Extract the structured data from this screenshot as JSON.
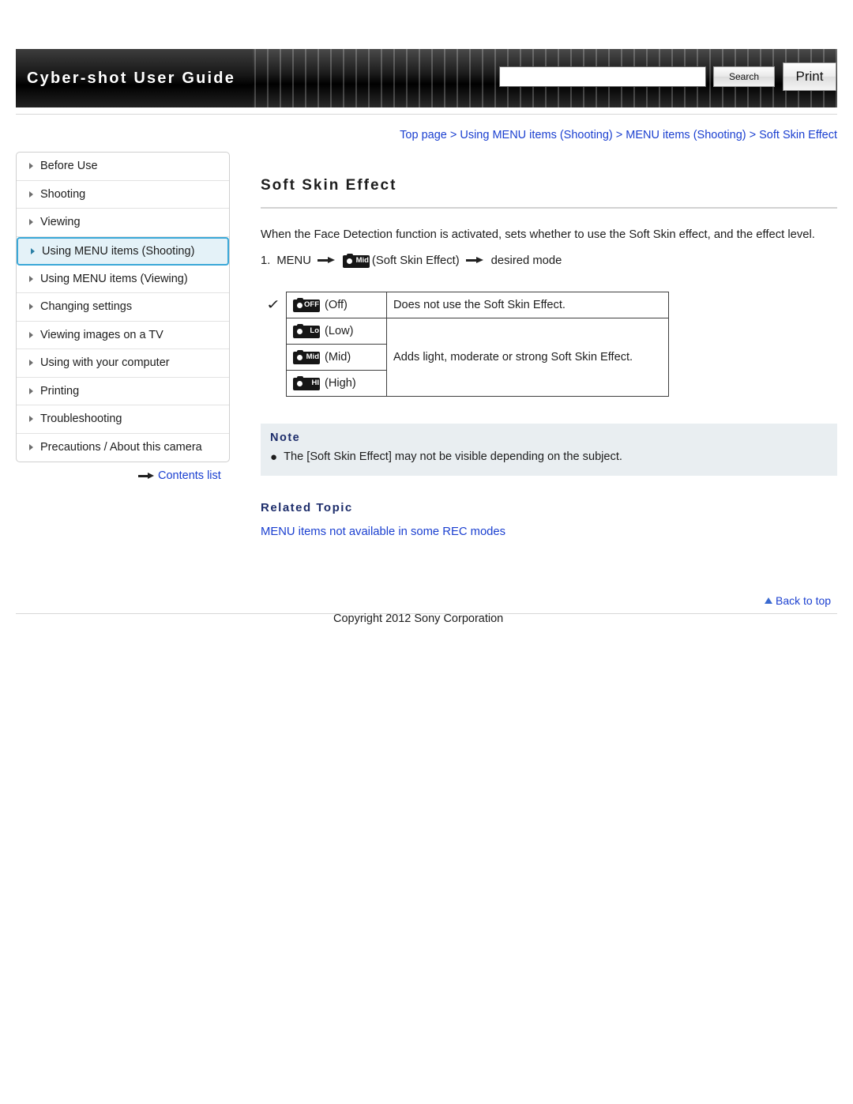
{
  "header": {
    "title": "Cyber-shot User Guide",
    "search_placeholder": "",
    "search_value": "",
    "search_label": "Search",
    "print_label": "Print"
  },
  "breadcrumb": {
    "items": [
      "Top page",
      "Using MENU items (Shooting)",
      "MENU items (Shooting)",
      "Soft Skin Effect"
    ],
    "separator": ">"
  },
  "sidebar": {
    "items": [
      {
        "label": "Before Use",
        "selected": false
      },
      {
        "label": "Shooting",
        "selected": false
      },
      {
        "label": "Viewing",
        "selected": false
      },
      {
        "label": "Using MENU items (Shooting)",
        "selected": true
      },
      {
        "label": "Using MENU items (Viewing)",
        "selected": false
      },
      {
        "label": "Changing settings",
        "selected": false
      },
      {
        "label": "Viewing images on a TV",
        "selected": false
      },
      {
        "label": "Using with your computer",
        "selected": false
      },
      {
        "label": "Printing",
        "selected": false
      },
      {
        "label": "Troubleshooting",
        "selected": false
      },
      {
        "label": "Precautions / About this camera",
        "selected": false
      }
    ],
    "contents_link": "Contents list"
  },
  "main": {
    "title": "Soft Skin Effect",
    "intro": "When the Face Detection function is activated, sets whether to use the Soft Skin effect, and the effect level.",
    "step": {
      "number": "1.",
      "text_start": "MENU",
      "icon_label": "Mid",
      "icon_caption": "(Soft Skin Effect)",
      "text_end": "desired mode"
    },
    "options": [
      {
        "checked": true,
        "icon": "OFF",
        "label": "(Off)",
        "desc": "Does not use the Soft Skin Effect."
      },
      {
        "checked": false,
        "icon": "Lo",
        "label": "(Low)",
        "desc": ""
      },
      {
        "checked": false,
        "icon": "Mid",
        "label": "(Mid)",
        "desc": "Adds light, moderate or strong Soft Skin Effect."
      },
      {
        "checked": false,
        "icon": "HI",
        "label": "(High)",
        "desc": ""
      }
    ],
    "note": {
      "title": "Note",
      "items": [
        "The [Soft Skin Effect] may not be visible depending on the subject."
      ]
    },
    "related": {
      "title": "Related Topic",
      "links": [
        "MENU items not available in some REC modes"
      ]
    }
  },
  "footer": {
    "back_to_top": "Back to top",
    "copyright": "Copyright 2012 Sony Corporation"
  }
}
